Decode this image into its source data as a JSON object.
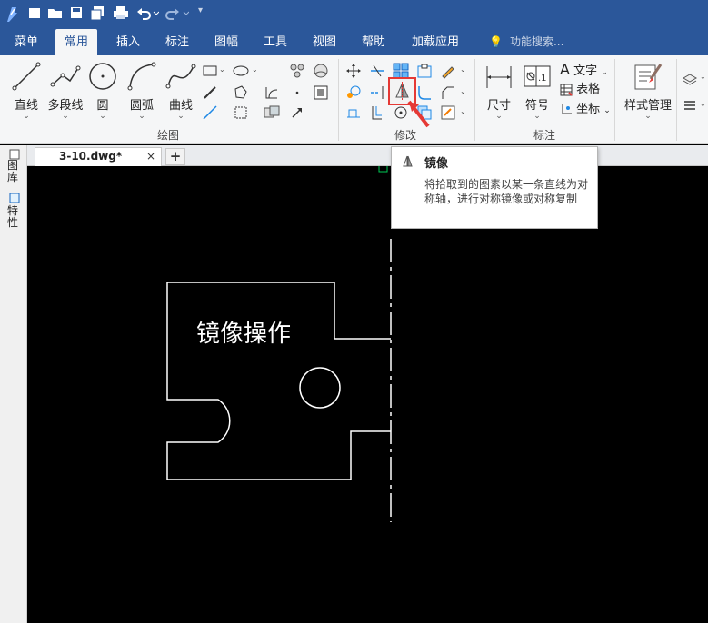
{
  "titlebar": {
    "bg": "#2b579a",
    "quick_access": [
      "app-logo-icon",
      "new-file-icon",
      "open-folder-icon",
      "save-icon",
      "save-all-icon",
      "print-icon",
      "undo-icon",
      "redo-icon"
    ]
  },
  "menu": {
    "tabs": [
      "菜单",
      "常用",
      "插入",
      "标注",
      "图幅",
      "工具",
      "视图",
      "帮助",
      "加载应用"
    ],
    "active": "常用",
    "search_placeholder": "功能搜索..."
  },
  "ribbon": {
    "draw": {
      "label": "绘图",
      "buttons": [
        "直线",
        "多段线",
        "圆",
        "圆弧",
        "曲线"
      ]
    },
    "modify": {
      "label": "修改",
      "highlighted": "mirror-icon"
    },
    "annotate": {
      "label": "标注",
      "buttons": [
        "尺寸",
        "符号"
      ],
      "rows": [
        "文字",
        "表格",
        "坐标"
      ]
    },
    "style": {
      "button": "样式管理"
    }
  },
  "document": {
    "tab": "3-10.dwg*",
    "close": "×",
    "add": "+"
  },
  "sidebar": {
    "items": [
      "图库",
      "特性"
    ]
  },
  "canvas": {
    "text": "镜像操作",
    "bg": "#000000",
    "line_color": "#ffffff"
  },
  "tooltip": {
    "title": "镜像",
    "description": "将拾取到的图素以某一条直线为对称轴，进行对称镜像或对称复制"
  },
  "accent": {
    "highlight": "#e53935"
  }
}
